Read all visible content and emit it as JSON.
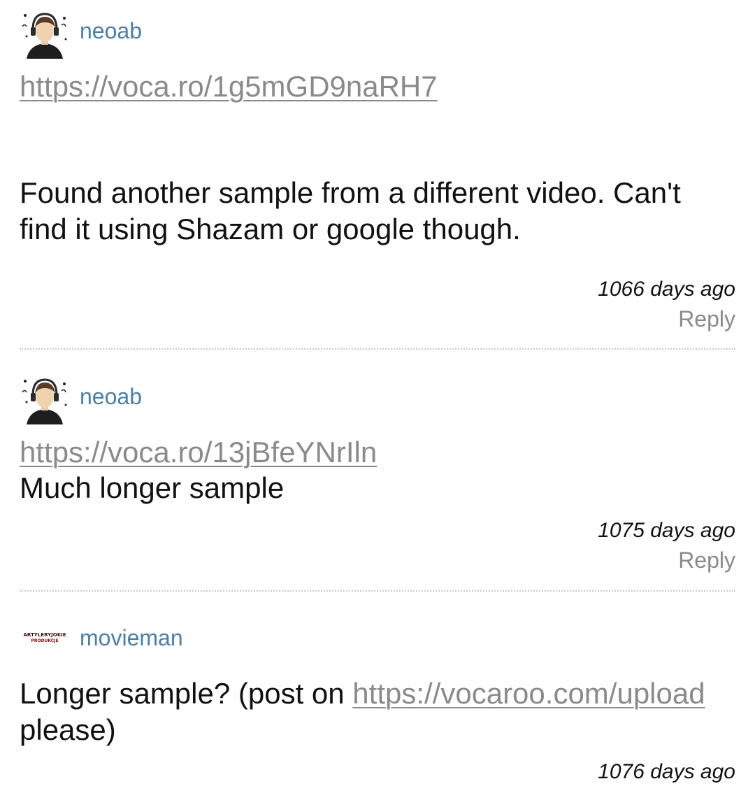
{
  "comments": [
    {
      "username": "neoab",
      "link": "https://voca.ro/1g5mGD9naRH7",
      "text": "Found another sample from a different video. Can't find it using Shazam or google though.",
      "timestamp": "1066 days ago",
      "reply_label": "Reply",
      "avatar_icon": "headphones-person-avatar-icon"
    },
    {
      "username": "neoab",
      "link": "https://voca.ro/13jBfeYNrIln",
      "text": "Much longer sample",
      "timestamp": "1075 days ago",
      "reply_label": "Reply",
      "avatar_icon": "headphones-person-avatar-icon"
    },
    {
      "username": "movieman",
      "text_before": "Longer sample? (post on ",
      "link": "https://vocaroo.com/upload",
      "text_after": " please)",
      "timestamp": "1076 days ago",
      "avatar_icon": "artylerystarsky-logo-avatar-icon",
      "avatar_logo_text": [
        "ARTYLERYJOKIE",
        "PRODUKCJE"
      ]
    }
  ],
  "colors": {
    "username": "#4a7fa8",
    "link": "#8a8a8a",
    "text": "#111111",
    "divider": "#c9c9c9"
  }
}
